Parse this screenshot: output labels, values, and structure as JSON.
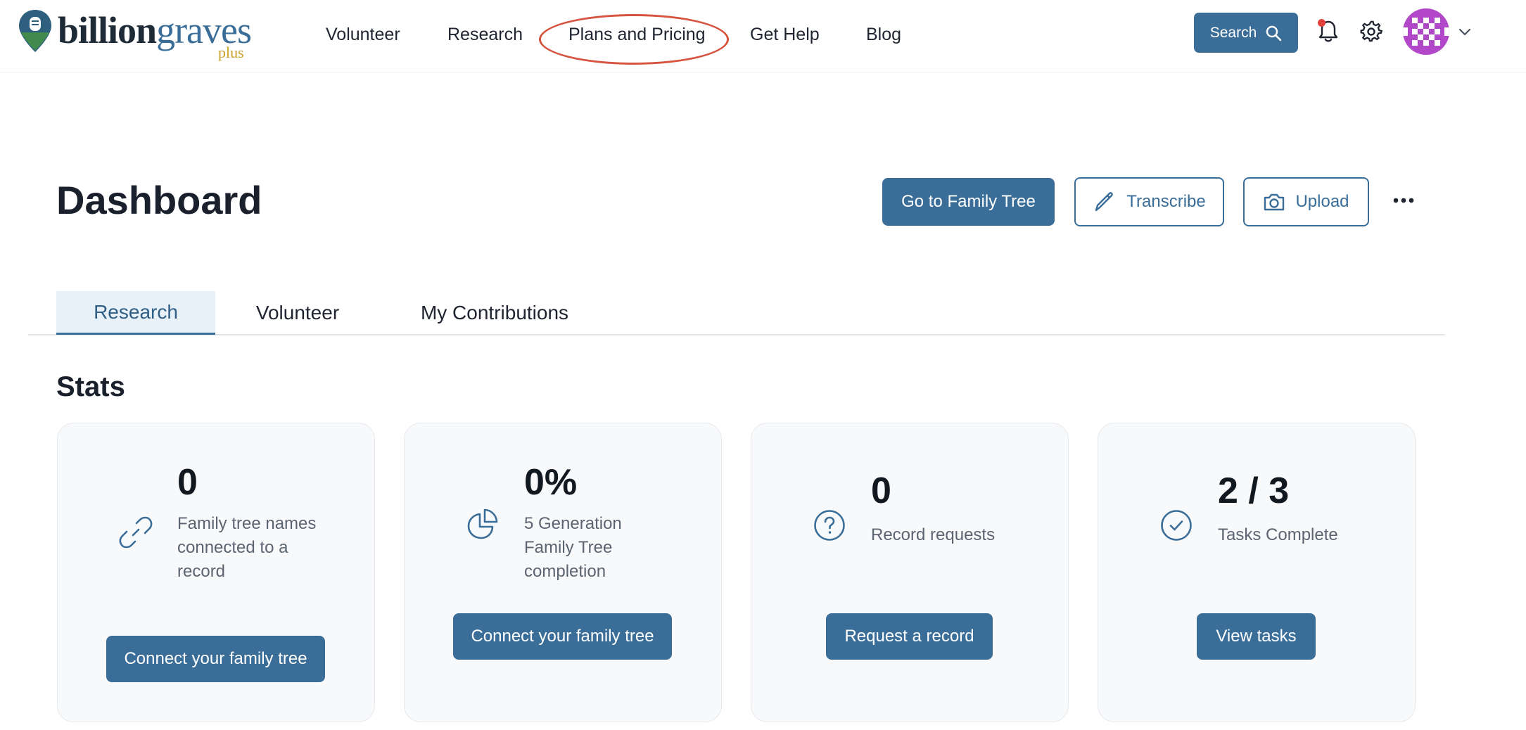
{
  "brand": {
    "logo_word_dark": "billion",
    "logo_word_blue": "graves",
    "logo_plus": "plus",
    "primary_color": "#3a6e98",
    "accent_gold": "#c9a227"
  },
  "nav": {
    "links": [
      "Volunteer",
      "Research",
      "Plans and Pricing",
      "Get Help",
      "Blog"
    ],
    "highlighted": "Plans and Pricing",
    "search_label": "Search",
    "icons": [
      "search-icon",
      "bell-icon",
      "gear-icon",
      "avatar",
      "chevron-down-icon"
    ]
  },
  "header": {
    "title": "Dashboard",
    "family_tree_button": "Go to Family Tree",
    "transcribe_button": "Transcribe",
    "upload_button": "Upload",
    "more_icon": "ellipsis-icon"
  },
  "tabs": [
    "Research",
    "Volunteer",
    "My Contributions"
  ],
  "active_tab": "Research",
  "stats": {
    "title": "Stats",
    "cards": [
      {
        "icon": "link-icon",
        "value": "0",
        "label": "Family tree names connected to a record",
        "button": "Connect your family tree"
      },
      {
        "icon": "pie-chart-icon",
        "value": "0%",
        "label": "5 Generation Family Tree completion",
        "button": "Connect your family tree"
      },
      {
        "icon": "question-icon",
        "value": "0",
        "label": "Record requests",
        "button": "Request a record"
      },
      {
        "icon": "check-circle-icon",
        "value": "2 / 3",
        "label": "Tasks Complete",
        "button": "View tasks"
      }
    ]
  }
}
